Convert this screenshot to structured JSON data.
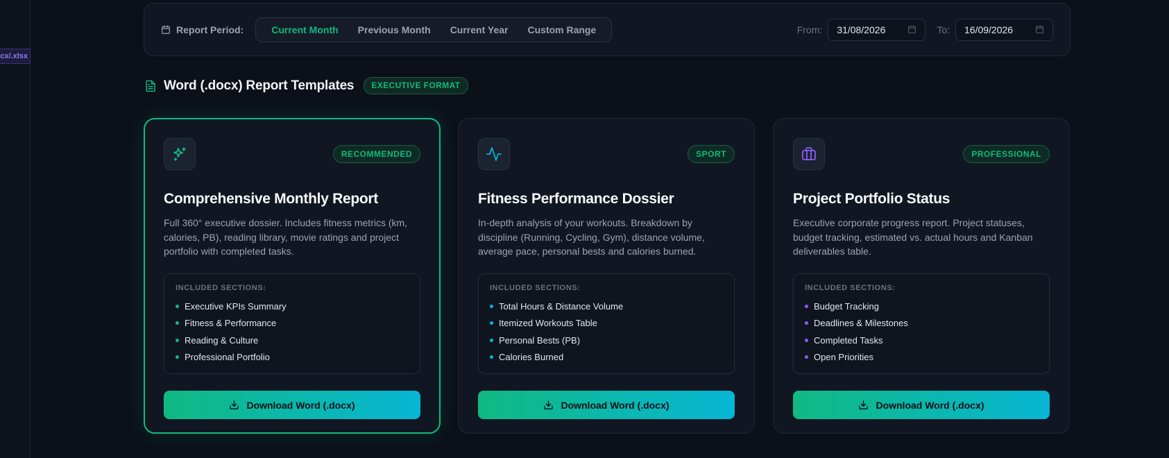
{
  "sidebar": {
    "tag": "cx/.xlsx"
  },
  "period": {
    "label": "Report Period:",
    "options": [
      "Current Month",
      "Previous Month",
      "Current Year",
      "Custom Range"
    ],
    "active": "Current Month",
    "from_label": "From:",
    "from_value": "31/08/2026",
    "to_label": "To:",
    "to_value": "16/09/2026"
  },
  "section": {
    "title": "Word (.docx) Report Templates",
    "badge": "EXECUTIVE FORMAT"
  },
  "colors": {
    "accent": "#10b981",
    "cyan": "#06b6d4",
    "purple": "#8b5cf6"
  },
  "cards": [
    {
      "icon": "sparkles-icon",
      "badge": "RECOMMENDED",
      "title": "Comprehensive Monthly Report",
      "description": "Full 360° executive dossier. Includes fitness metrics (km, calories, PB), reading library, movie ratings and project portfolio with completed tasks.",
      "sections_label": "INCLUDED SECTIONS:",
      "sections": [
        "Executive KPIs Summary",
        "Fitness & Performance",
        "Reading & Culture",
        "Professional Portfolio"
      ],
      "dot_color": "#10b981",
      "button": "Download Word (.docx)",
      "selected": true
    },
    {
      "icon": "activity-icon",
      "badge": "SPORT",
      "title": "Fitness Performance Dossier",
      "description": "In-depth analysis of your workouts. Breakdown by discipline (Running, Cycling, Gym), distance volume, average pace, personal bests and calories burned.",
      "sections_label": "INCLUDED SECTIONS:",
      "sections": [
        "Total Hours & Distance Volume",
        "Itemized Workouts Table",
        "Personal Bests (PB)",
        "Calories Burned"
      ],
      "dot_color": "#06b6d4",
      "button": "Download Word (.docx)",
      "selected": false
    },
    {
      "icon": "briefcase-icon",
      "badge": "PROFESSIONAL",
      "title": "Project Portfolio Status",
      "description": "Executive corporate progress report. Project statuses, budget tracking, estimated vs. actual hours and Kanban deliverables table.",
      "sections_label": "INCLUDED SECTIONS:",
      "sections": [
        "Budget Tracking",
        "Deadlines & Milestones",
        "Completed Tasks",
        "Open Priorities"
      ],
      "dot_color": "#8b5cf6",
      "button": "Download Word (.docx)",
      "selected": false
    }
  ]
}
